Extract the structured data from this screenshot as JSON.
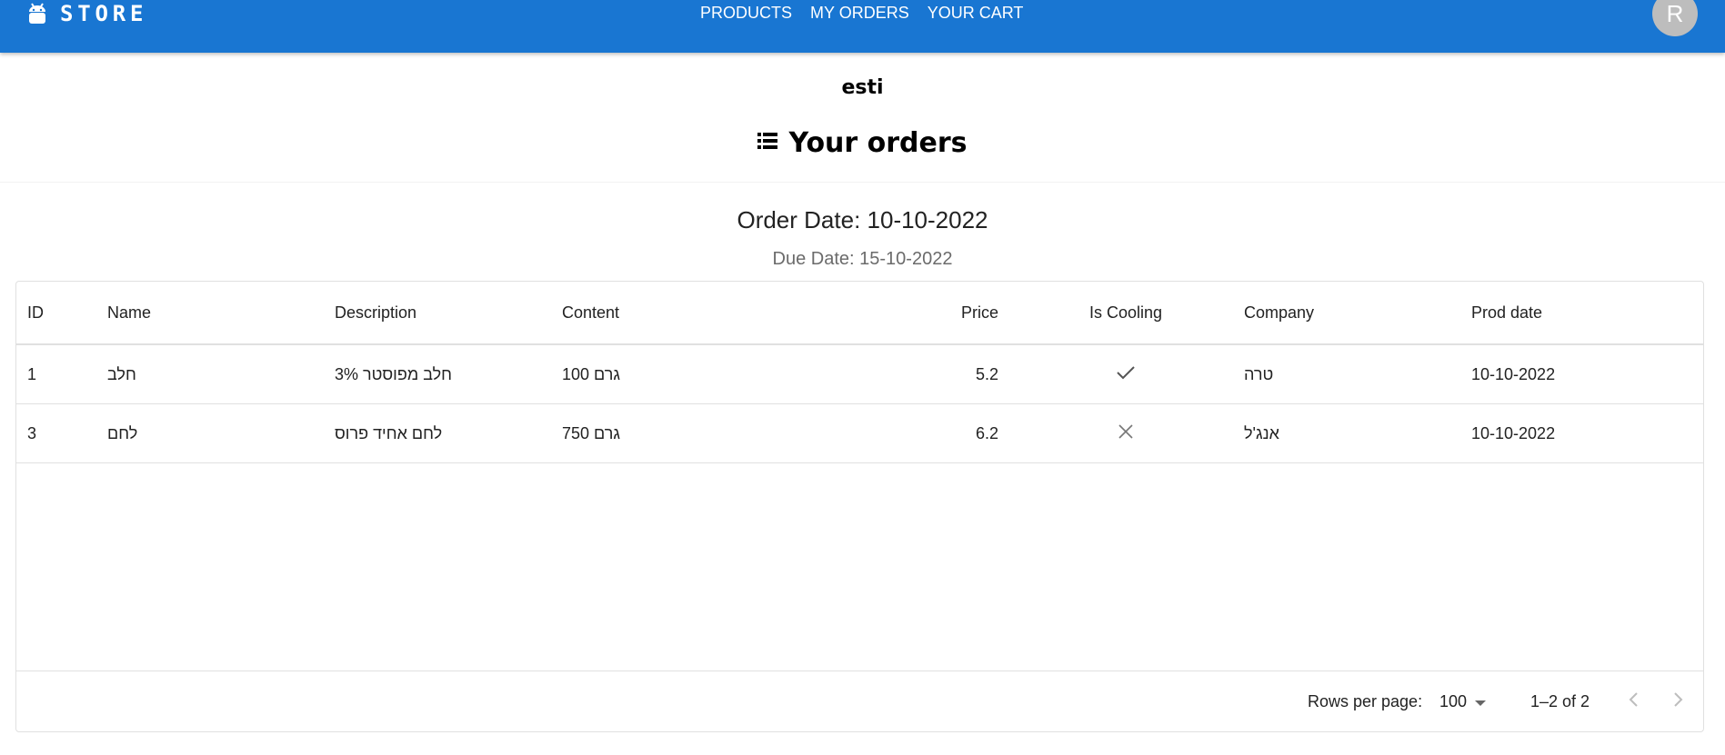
{
  "brand": "STORE",
  "nav": [
    "PRODUCTS",
    "MY ORDERS",
    "YOUR CART"
  ],
  "avatar": "R",
  "user": "esti",
  "page_title": "Your orders",
  "order_date": "Order Date: 10-10-2022",
  "due_date": "Due Date: 15-10-2022",
  "table": {
    "columns": [
      "ID",
      "Name",
      "Description",
      "Content",
      "Price",
      "Is Cooling",
      "Company",
      "Prod date"
    ],
    "rows": [
      {
        "id": "1",
        "name": "חלב",
        "description": "חלב מפוסטר 3%",
        "content": "100 גרם",
        "price": "5.2",
        "cooling": "check-icon",
        "company": "טרה",
        "prod_date": "10-10-2022"
      },
      {
        "id": "3",
        "name": "לחם",
        "description": "לחם אחיד פרוס",
        "content": "750 גרם",
        "price": "6.2",
        "cooling": "cross-icon",
        "company": "אנג'ל",
        "prod_date": "10-10-2022"
      }
    ]
  },
  "pagination": {
    "rows_per_page_label": "Rows per page:",
    "rows_per_page": "100",
    "range": "1–2 of 2"
  },
  "colors": {
    "appbar": "#1976d2",
    "avatar": "#bdbdbd"
  }
}
